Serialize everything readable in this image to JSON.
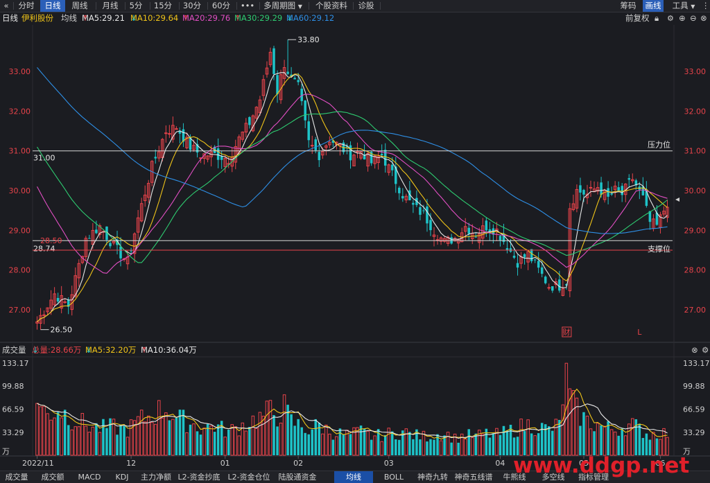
{
  "toolbar": {
    "back_icon": "double-left-chevron",
    "periods": [
      "分时",
      "日线",
      "周线",
      "月线",
      "5分",
      "15分",
      "30分",
      "60分"
    ],
    "active_period": "日线",
    "more": "•••",
    "multi_period": "多周期图",
    "stock_info": "个股资料",
    "diagnose": "诊股",
    "chips": "筹码",
    "draw": "画线",
    "tools": "工具"
  },
  "ma_header": {
    "period": "日线",
    "stock_name": "伊利股份",
    "ma_label": "均线",
    "ma5": "MA5:29.21",
    "ma10": "MA10:29.64",
    "ma20": "MA20:29.76",
    "ma30": "MA30:29.29",
    "ma60": "MA60:29.12",
    "adjust": "前复权"
  },
  "colors": {
    "ma5": "#e8e8e8",
    "ma10": "#f0c419",
    "ma20": "#e24fc4",
    "ma30": "#2ecc71",
    "ma60": "#2e8fe6",
    "up": "#e8434a",
    "down": "#1ec3c8",
    "axis_text": "#e8434a",
    "support": "#e8434a"
  },
  "chart_data": [
    {
      "type": "candlestick",
      "title": "伊利股份 日线",
      "y_ticks": [
        27.0,
        28.0,
        29.0,
        30.0,
        31.0,
        32.0,
        33.0
      ],
      "y_tick_labels": [
        "27.00",
        "28.00",
        "29.00",
        "30.00",
        "31.00",
        "32.00",
        "33.00"
      ],
      "ylim": [
        26.25,
        34.1
      ],
      "x_tick_labels": [
        "2022/11",
        "12",
        "01",
        "02",
        "03",
        "04",
        "05",
        "06"
      ],
      "x_tick_index": [
        0,
        27,
        54,
        75,
        101,
        133,
        157,
        179
      ],
      "n_bars": 182,
      "close_keyframes": [
        [
          0,
          26.7
        ],
        [
          5,
          27.4
        ],
        [
          9,
          27.1
        ],
        [
          14,
          28.8
        ],
        [
          18,
          29.1
        ],
        [
          22,
          28.6
        ],
        [
          26,
          28.2
        ],
        [
          29,
          29.3
        ],
        [
          33,
          30.6
        ],
        [
          37,
          31.5
        ],
        [
          40,
          31.6
        ],
        [
          44,
          31.1
        ],
        [
          47,
          30.9
        ],
        [
          51,
          30.9
        ],
        [
          55,
          30.8
        ],
        [
          58,
          31.3
        ],
        [
          61,
          31.7
        ],
        [
          64,
          32.3
        ],
        [
          67,
          33.5
        ],
        [
          69,
          32.5
        ],
        [
          71,
          33.2
        ],
        [
          73,
          32.8
        ],
        [
          75,
          32.6
        ],
        [
          78,
          31.2
        ],
        [
          81,
          30.9
        ],
        [
          84,
          31.3
        ],
        [
          87,
          31.1
        ],
        [
          90,
          30.9
        ],
        [
          93,
          31.0
        ],
        [
          96,
          30.7
        ],
        [
          99,
          30.9
        ],
        [
          102,
          30.4
        ],
        [
          105,
          29.9
        ],
        [
          108,
          29.6
        ],
        [
          111,
          29.4
        ],
        [
          114,
          29.0
        ],
        [
          117,
          28.7
        ],
        [
          120,
          28.8
        ],
        [
          123,
          29.1
        ],
        [
          126,
          28.9
        ],
        [
          129,
          29.1
        ],
        [
          132,
          29.0
        ],
        [
          135,
          28.6
        ],
        [
          138,
          28.2
        ],
        [
          141,
          28.4
        ],
        [
          144,
          28.0
        ],
        [
          147,
          27.6
        ],
        [
          150,
          27.6
        ],
        [
          152,
          27.7
        ],
        [
          153,
          29.6
        ],
        [
          155,
          30.0
        ],
        [
          158,
          29.9
        ],
        [
          161,
          30.1
        ],
        [
          164,
          29.8
        ],
        [
          166,
          30.0
        ],
        [
          168,
          29.9
        ],
        [
          171,
          30.3
        ],
        [
          174,
          29.8
        ],
        [
          176,
          29.2
        ],
        [
          178,
          29.1
        ],
        [
          181,
          29.7
        ]
      ],
      "annotations": [
        {
          "text": "33.80",
          "kind": "high",
          "value": 33.8,
          "index": 72
        },
        {
          "text": "26.50",
          "kind": "low",
          "value": 26.5,
          "index": 1
        },
        {
          "text": "31.00",
          "kind": "line",
          "value": 31.0
        },
        {
          "text": "28.74",
          "kind": "line",
          "value": 28.74
        },
        {
          "text": "28.50",
          "kind": "line",
          "value": 28.5
        },
        {
          "text": "压力位",
          "kind": "label",
          "value": 31.0
        },
        {
          "text": "支撑位",
          "kind": "label",
          "value": 28.5
        }
      ],
      "markers": [
        {
          "text": "财",
          "index": 152
        },
        {
          "text": "L",
          "index": 173
        }
      ]
    },
    {
      "type": "bar",
      "title": "成交量",
      "y_ticks": [
        33.29,
        66.59,
        99.88,
        133.17
      ],
      "y_tick_labels": [
        "33.29",
        "66.59",
        "99.88",
        "133.17"
      ],
      "ylim": [
        0,
        133.17
      ],
      "unit": "万",
      "volume_keyframes": [
        [
          0,
          75
        ],
        [
          3,
          60
        ],
        [
          6,
          70
        ],
        [
          10,
          55
        ],
        [
          14,
          45
        ],
        [
          18,
          40
        ],
        [
          22,
          42
        ],
        [
          26,
          38
        ],
        [
          29,
          50
        ],
        [
          33,
          60
        ],
        [
          37,
          70
        ],
        [
          40,
          55
        ],
        [
          44,
          48
        ],
        [
          47,
          40
        ],
        [
          51,
          44
        ],
        [
          55,
          35
        ],
        [
          58,
          42
        ],
        [
          61,
          50
        ],
        [
          64,
          55
        ],
        [
          67,
          65
        ],
        [
          69,
          60
        ],
        [
          71,
          70
        ],
        [
          73,
          50
        ],
        [
          75,
          45
        ],
        [
          78,
          38
        ],
        [
          81,
          45
        ],
        [
          84,
          35
        ],
        [
          87,
          32
        ],
        [
          90,
          30
        ],
        [
          93,
          35
        ],
        [
          96,
          28
        ],
        [
          99,
          30
        ],
        [
          102,
          32
        ],
        [
          105,
          35
        ],
        [
          108,
          30
        ],
        [
          111,
          28
        ],
        [
          114,
          30
        ],
        [
          117,
          33
        ],
        [
          120,
          25
        ],
        [
          123,
          30
        ],
        [
          126,
          28
        ],
        [
          129,
          32
        ],
        [
          132,
          30
        ],
        [
          135,
          35
        ],
        [
          138,
          40
        ],
        [
          141,
          45
        ],
        [
          144,
          42
        ],
        [
          147,
          38
        ],
        [
          150,
          45
        ],
        [
          152,
          133
        ],
        [
          153,
          85
        ],
        [
          155,
          65
        ],
        [
          158,
          50
        ],
        [
          161,
          45
        ],
        [
          164,
          40
        ],
        [
          166,
          38
        ],
        [
          168,
          42
        ],
        [
          171,
          45
        ],
        [
          174,
          36
        ],
        [
          176,
          30
        ],
        [
          178,
          34
        ],
        [
          181,
          32
        ]
      ]
    }
  ],
  "volume_header": {
    "label": "成交量",
    "total": "总量:28.66万",
    "ma5": "MA5:32.20万",
    "ma10": "MA10:36.04万"
  },
  "bottom_tabs": [
    "成交量",
    "成交额",
    "MACD",
    "KDJ",
    "主力净额",
    "L2-资金抄底",
    "L2-资金仓位",
    "陆股通资金",
    "均线",
    "BOLL",
    "神奇九转",
    "神奇五线谱",
    "牛熊线",
    "多空线",
    "指标管理"
  ],
  "active_bottom_tab": "均线",
  "watermark": "www.ddgp.net"
}
